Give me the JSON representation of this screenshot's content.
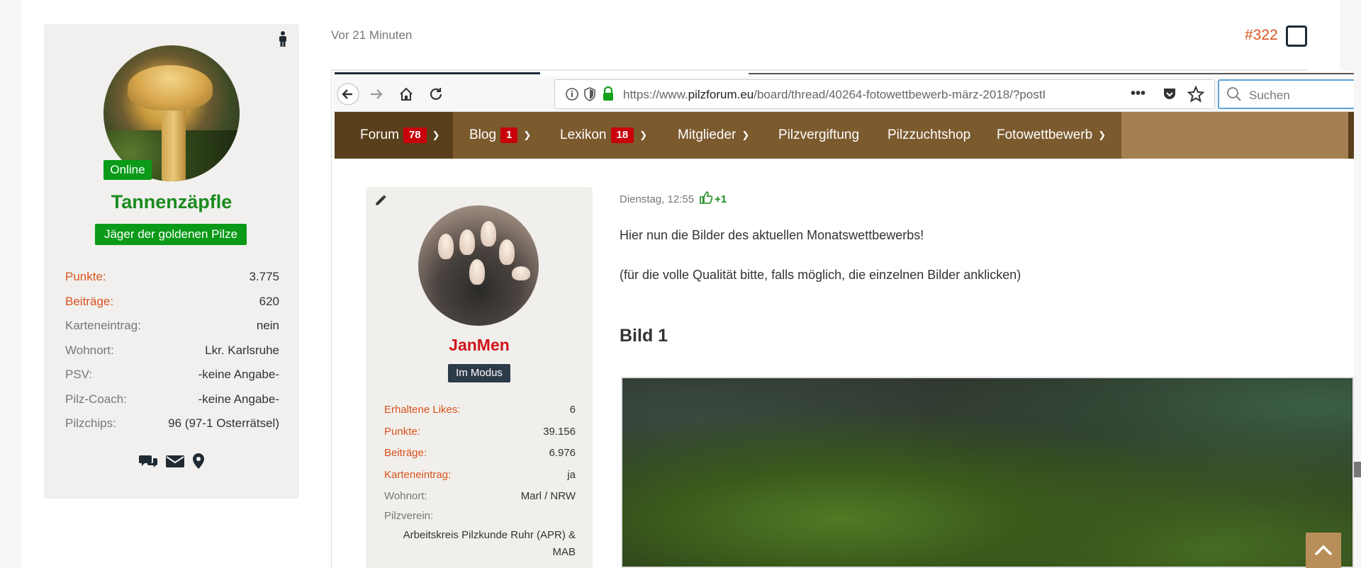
{
  "author": {
    "online_label": "Online",
    "username": "Tannenzäpfle",
    "rank": "Jäger der goldenen Pilze",
    "stats": [
      {
        "key": "Punkte:",
        "value": "3.775"
      },
      {
        "key": "Beiträge:",
        "value": "620"
      },
      {
        "key": "Karteneintrag:",
        "value": "nein"
      },
      {
        "key": "Wohnort:",
        "value": "Lkr. Karlsruhe"
      },
      {
        "key": "PSV:",
        "value": "-keine Angabe-"
      },
      {
        "key": "Pilz-Coach:",
        "value": "-keine Angabe-"
      },
      {
        "key": "Pilzchips:",
        "value": "96 (97-1 Osterrätsel)"
      }
    ],
    "icons": [
      "male-user-icon",
      "chat-icon",
      "envelope-icon",
      "map-marker-icon"
    ]
  },
  "post": {
    "time": "Vor 21 Minuten",
    "number": "#322"
  },
  "screenshot": {
    "url_prefix": "https://www.",
    "url_host": "pilzforum.eu",
    "url_rest": "/board/thread/40264-fotowettbewerb-märz-2018/?postI",
    "search_placeholder": "Suchen",
    "nav": [
      {
        "label": "Forum",
        "badge": "78"
      },
      {
        "label": "Blog",
        "badge": "1"
      },
      {
        "label": "Lexikon",
        "badge": "18"
      },
      {
        "label": "Mitglieder"
      },
      {
        "label": "Pilzvergiftung"
      },
      {
        "label": "Pilzzuchtshop"
      },
      {
        "label": "Fotowettbewerb"
      }
    ],
    "post": {
      "username": "JanMen",
      "role": "Im Modus",
      "stats": [
        {
          "key": "Erhaltene Likes:",
          "value": "6"
        },
        {
          "key": "Punkte:",
          "value": "39.156"
        },
        {
          "key": "Beiträge:",
          "value": "6.976"
        },
        {
          "key": "Karteneintrag:",
          "value": "ja"
        },
        {
          "key": "Wohnort:",
          "value": "Marl / NRW"
        }
      ],
      "verein_label": "Pilzverein:",
      "verein_value": "Arbeitskreis Pilzkunde Ruhr (APR) & MAB",
      "time": "Dienstag, 12:55",
      "likes": "+1",
      "paragraph1": "Hier nun die Bilder des aktuellen Monatswettbewerbs!",
      "paragraph2": "(für die volle Qualität bitte, falls möglich, die einzelnen Bilder anklicken)",
      "heading": "Bild 1"
    }
  },
  "colors": {
    "accent_orange": "#d9531e",
    "online_green": "#0a9a18",
    "username_green": "#1b8b1f",
    "nav_brown": "#7b5a2e",
    "badge_red": "#c8000a"
  }
}
